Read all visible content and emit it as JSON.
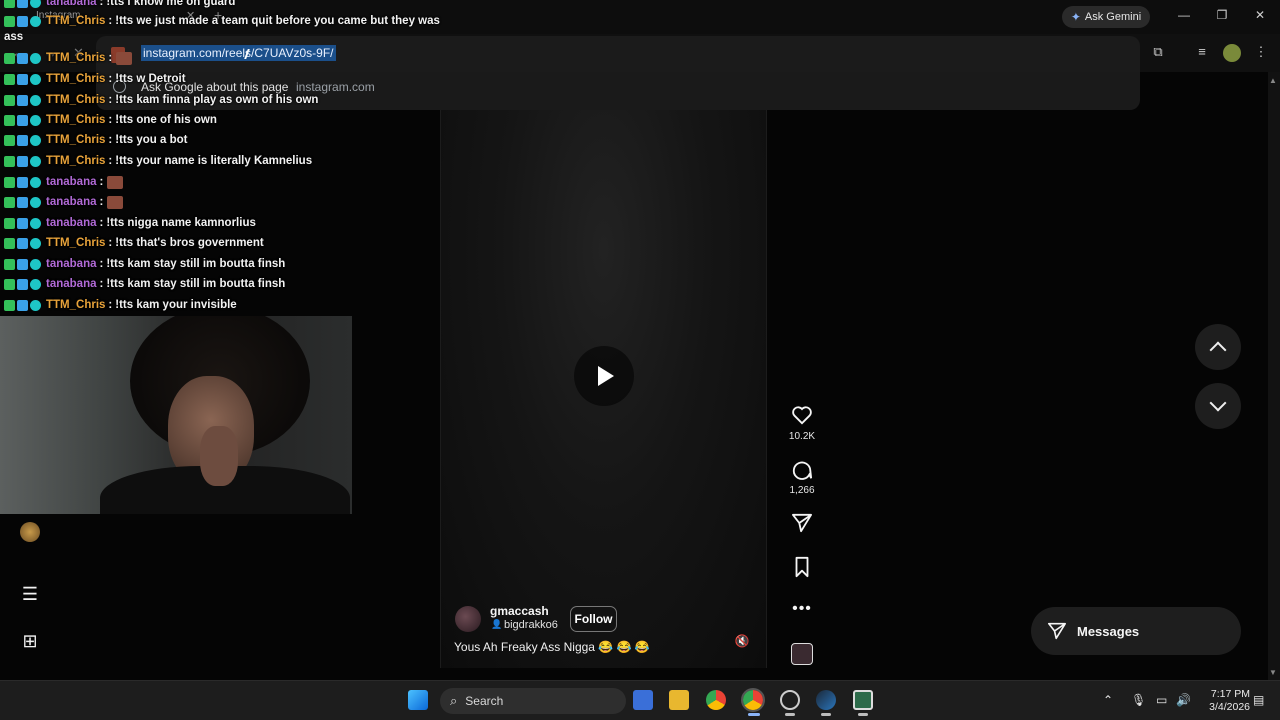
{
  "browser": {
    "tab_label": "Instagram",
    "gemini_label": "Ask Gemini",
    "omnibox_url": "instagram.com/reels/C7UAVz0s-9F/",
    "suggestion_label": "Ask Google about this page",
    "suggestion_source": "instagram.com"
  },
  "chat": {
    "lines": [
      {
        "user": "tanabana",
        "sep": ":",
        "text": "!tts i know me on guard",
        "user_type": "tana"
      },
      {
        "user": "TTM_Chris",
        "sep": ":",
        "text": "!tts we just made a team quit before you came but they was",
        "user_type": "chris"
      },
      {
        "user": "TTM_Chris",
        "sep": ":",
        "text": "",
        "user_type": "chris",
        "emote": true
      },
      {
        "user": "TTM_Chris",
        "sep": ":",
        "text": "!tts w Detroit",
        "user_type": "chris"
      },
      {
        "user": "TTM_Chris",
        "sep": ":",
        "text": "!tts kam finna play as own of his own",
        "user_type": "chris"
      },
      {
        "user": "TTM_Chris",
        "sep": ":",
        "text": "!tts one of his own",
        "user_type": "chris"
      },
      {
        "user": "TTM_Chris",
        "sep": ":",
        "text": "!tts you a bot",
        "user_type": "chris"
      },
      {
        "user": "TTM_Chris",
        "sep": ":",
        "text": "!tts your name is literally Kamnelius",
        "user_type": "chris"
      },
      {
        "user": "tanabana",
        "sep": ":",
        "text": "",
        "user_type": "tana",
        "emote": true
      },
      {
        "user": "tanabana",
        "sep": ":",
        "text": "",
        "user_type": "tana",
        "emote": true
      },
      {
        "user": "tanabana",
        "sep": ":",
        "text": "!tts nigga name kamnorlius",
        "user_type": "tana"
      },
      {
        "user": "TTM_Chris",
        "sep": ":",
        "text": "!tts that's bros government",
        "user_type": "chris"
      },
      {
        "user": "tanabana",
        "sep": ":",
        "text": "!tts kam stay still im boutta finsh",
        "user_type": "tana"
      },
      {
        "user": "tanabana",
        "sep": ":",
        "text": "!tts kam stay still im boutta finsh",
        "user_type": "tana"
      },
      {
        "user": "TTM_Chris",
        "sep": ":",
        "text": "!tts kam your invisible",
        "user_type": "chris"
      }
    ],
    "wrap_text": "ass"
  },
  "reel": {
    "author": "gmaccash",
    "collaborator": "bigdrakko6",
    "follow_label": "Follow",
    "caption": "Yous Ah Freaky Ass Nigga 😂 😂 😂",
    "likes": "10.2K",
    "comments": "1,266"
  },
  "instagram": {
    "messages_label": "Messages"
  },
  "taskbar": {
    "search_label": "Search",
    "time": "7:17 PM",
    "date": "3/4/2026"
  },
  "colors": {
    "chris": "#e8a33a",
    "tana": "#b16ad6",
    "omnibox_highlight": "#1b4f8a"
  }
}
